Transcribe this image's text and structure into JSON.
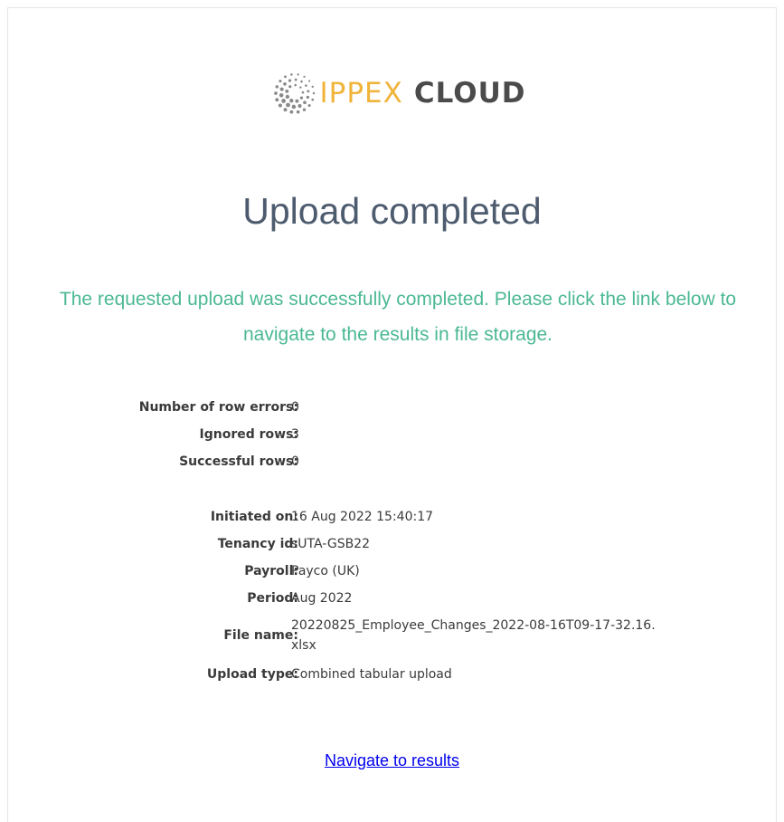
{
  "brand": {
    "name_part1": "IPPEX",
    "name_part2": "CLOUD",
    "colors": {
      "accent": "#f0b43a",
      "dark": "#4b4b4b",
      "dots": "#8a8a8a"
    }
  },
  "title": "Upload completed",
  "message": "The requested upload was successfully completed. Please click the link below to navigate to the results in file storage.",
  "colors": {
    "title": "#4d5b6e",
    "message": "#4bb894",
    "link": "#0000ee"
  },
  "summary": [
    {
      "label": "Number of row errors:",
      "value": "0"
    },
    {
      "label": "Ignored rows:",
      "value": "3"
    },
    {
      "label": "Successful rows:",
      "value": "0"
    }
  ],
  "details": [
    {
      "label": "Initiated on:",
      "value": "16 Aug 2022 15:40:17"
    },
    {
      "label": "Tenancy id:",
      "value": "sUTA-GSB22"
    },
    {
      "label": "Payroll:",
      "value": "Payco (UK)"
    },
    {
      "label": "Period:",
      "value": "Aug 2022"
    },
    {
      "label": "File name:",
      "value": "20220825_Employee_Changes_2022-08-16T09-17-32.16.xlsx"
    },
    {
      "label": "Upload type:",
      "value": "Combined tabular upload"
    }
  ],
  "link": {
    "label": "Navigate to results"
  }
}
